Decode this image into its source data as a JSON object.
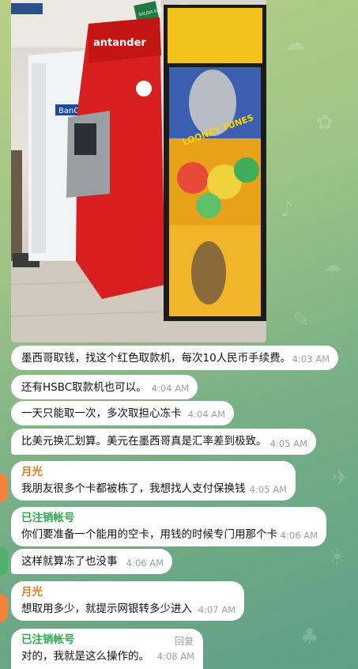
{
  "colors": {
    "bubble_bg": "#ffffff",
    "time_color": "#9aa0a6",
    "sender_orange": "#e07b2a",
    "sender_green": "#2fa84f",
    "avatar_orange": "#f3823a",
    "avatar_green": "#4db06b"
  },
  "photo": {
    "kiosk_sign_text": "SALIDA DE EVACUACION",
    "bank_brand_text": "antander",
    "bancomer_text": "BanCo",
    "looney_text": "LOONEY TUNES"
  },
  "messages": [
    {
      "text": "墨西哥取钱，找这个红色取款机，每次10人民币手续费。",
      "time": "4:03 AM"
    },
    {
      "text": "还有HSBC取款机也可以。",
      "time": "4:04 AM"
    },
    {
      "text": "一天只能取一次，多次取担心冻卡",
      "time": "4:04 AM"
    },
    {
      "text": "比美元换汇划算。美元在墨西哥真是汇率差到极致。",
      "time": "4:05 AM"
    },
    {
      "sender": "月光",
      "text": "我朋友很多个卡都被栋了，我想找人支付保换钱",
      "time": "4:05 AM"
    },
    {
      "sender": "已注销帐号",
      "text": "你们要准备一个能用的空卡，用钱的时候专门用那个卡",
      "time": "4:06 AM"
    },
    {
      "text": "这样就算冻了也没事",
      "time": "4:06 AM"
    },
    {
      "sender": "月光",
      "text": "想取用多少，就提示网银转多少进入",
      "time": "4:07 AM"
    },
    {
      "sender": "已注销帐号",
      "text": "对的，我就是这么操作的。",
      "time": "4:08 AM",
      "reply_label": "回复"
    }
  ]
}
